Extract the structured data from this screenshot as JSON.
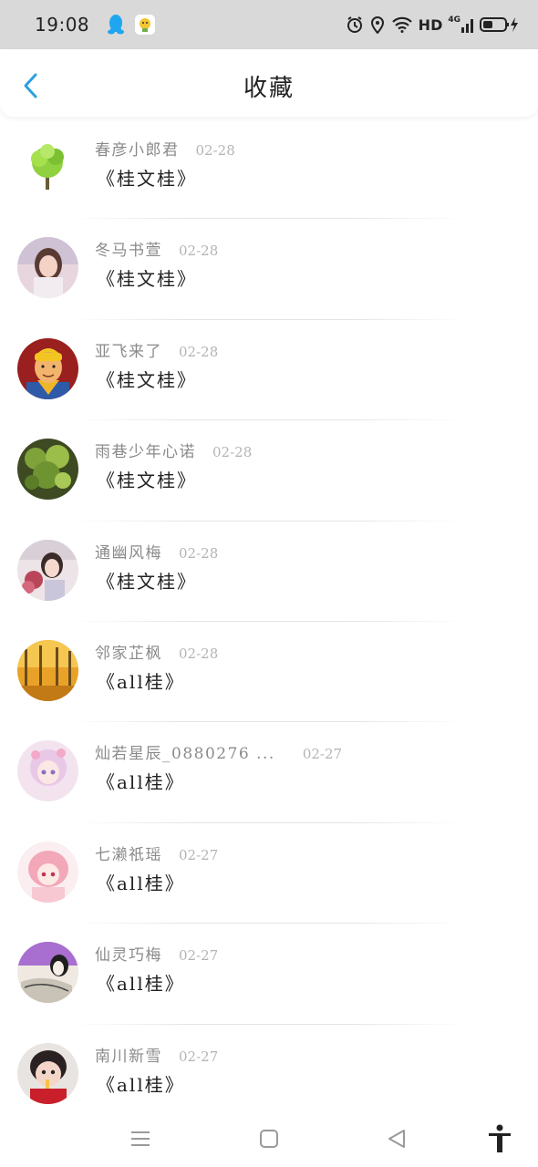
{
  "status_bar": {
    "time": "19:08",
    "icons": [
      "qq-icon",
      "app-icon",
      "alarm-icon",
      "location-icon",
      "wifi-icon"
    ],
    "hd": "HD",
    "network": "4G",
    "battery_icon": "battery-charging-icon"
  },
  "header": {
    "back_icon": "chevron-left-icon",
    "title": "收藏",
    "accent_color": "#2aa0e0"
  },
  "items": [
    {
      "name": "春彦小郎君",
      "date": "02-28",
      "title": "《桂文桂》",
      "avatar": "tree"
    },
    {
      "name": "冬马书萱",
      "date": "02-28",
      "title": "《桂文桂》",
      "avatar": "girl-photo"
    },
    {
      "name": "亚飞来了",
      "date": "02-28",
      "title": "《桂文桂》",
      "avatar": "cartoon-man"
    },
    {
      "name": "雨巷少年心诺",
      "date": "02-28",
      "title": "《桂文桂》",
      "avatar": "plant"
    },
    {
      "name": "通幽风梅",
      "date": "02-28",
      "title": "《桂文桂》",
      "avatar": "girl-flowers"
    },
    {
      "name": "邻家芷枫",
      "date": "02-28",
      "title": "《all桂》",
      "avatar": "autumn-forest"
    },
    {
      "name": "灿若星辰_0880276 ...",
      "date": "02-27",
      "title": "《all桂》",
      "avatar": "anime-girl"
    },
    {
      "name": "七濑祇瑶",
      "date": "02-27",
      "title": "《all桂》",
      "avatar": "anime-pink"
    },
    {
      "name": "仙灵巧梅",
      "date": "02-27",
      "title": "《all桂》",
      "avatar": "illustration"
    },
    {
      "name": "南川新雪",
      "date": "02-27",
      "title": "《all桂》",
      "avatar": "child-photo"
    }
  ],
  "nav_bar": {
    "icons": [
      "menu-icon",
      "home-square-icon",
      "back-triangle-icon",
      "accessibility-icon"
    ]
  }
}
